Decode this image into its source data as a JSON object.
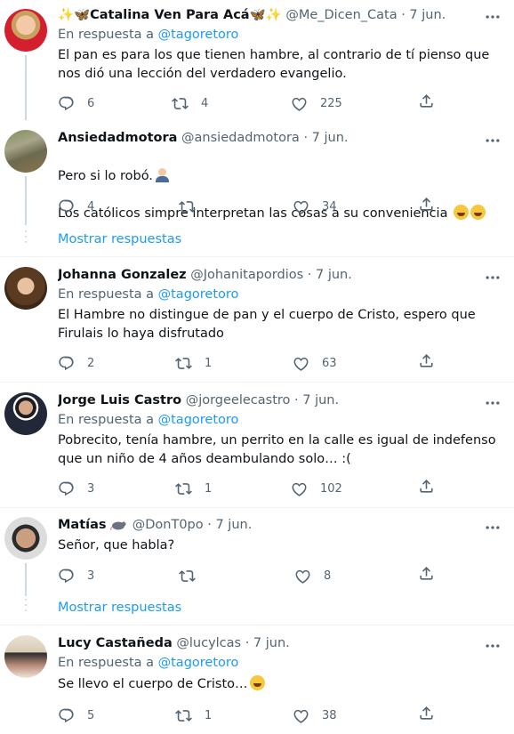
{
  "tweets": [
    {
      "name": "✨🦋Catalina Ven Para Acá🦋✨",
      "handle": "@Me_Dicen_Cata",
      "date": "· 7 jun.",
      "reply_prefix": "En respuesta a ",
      "reply_to": "@tagoretoro",
      "text": "El pan es para los que tienen hambre, al contrario de tí pienso que nos dió una lección del verdadero evangelio.",
      "replies": "6",
      "retweets": "4",
      "likes": "225"
    },
    {
      "name": "Ansiedadmotora",
      "handle": "@ansiedadmotora",
      "date": "· 7 jun.",
      "text_line1": "Pero si lo robó.",
      "text_line2": "Los católicos simpre interpretan las cosas a su conveniencia",
      "replies": "4",
      "retweets": "",
      "likes": "34"
    },
    {
      "name": "Johanna Gonzalez",
      "handle": "@Johanitapordios",
      "date": "· 7 jun.",
      "reply_prefix": "En respuesta a ",
      "reply_to": "@tagoretoro",
      "text": "El Hambre no distingue de pan y el cuerpo de Cristo, espero que Firulais lo haya disfrutado",
      "replies": "2",
      "retweets": "1",
      "likes": "63"
    },
    {
      "name": "Jorge Luis Castro",
      "handle": "@jorgeelecastro",
      "date": "· 7 jun.",
      "reply_prefix": "En respuesta a ",
      "reply_to": "@tagoretoro",
      "text": "Pobrecito, tenía hambre, un perrito en la calle es igual de indefenso que un niño de 4 años deambulando solo… :(",
      "replies": "3",
      "retweets": "1",
      "likes": "102"
    },
    {
      "name": "Matías",
      "handle": "@DonT0po",
      "date": "· 7 jun.",
      "text": "Señor, que habla?",
      "replies": "3",
      "retweets": "",
      "likes": "8"
    },
    {
      "name": "Lucy Castañeda",
      "handle": "@lucylcas",
      "date": "· 7 jun.",
      "reply_prefix": "En respuesta a ",
      "reply_to": "@tagoretoro",
      "text": "Se llevo el cuerpo de Cristo…",
      "replies": "5",
      "retweets": "1",
      "likes": "38"
    }
  ],
  "show_replies_label": "Mostrar respuestas",
  "colors": {
    "link": "#1d9bf0",
    "secondary_text": "#536471",
    "thread_line": "#cfd9de",
    "divider": "#eff3f4"
  },
  "icons": [
    "more-icon",
    "reply-icon",
    "retweet-icon",
    "like-icon",
    "share-icon",
    "rat-emoji-icon",
    "rolling-laughing-emoji-icon",
    "facepalm-emoji-icon"
  ]
}
